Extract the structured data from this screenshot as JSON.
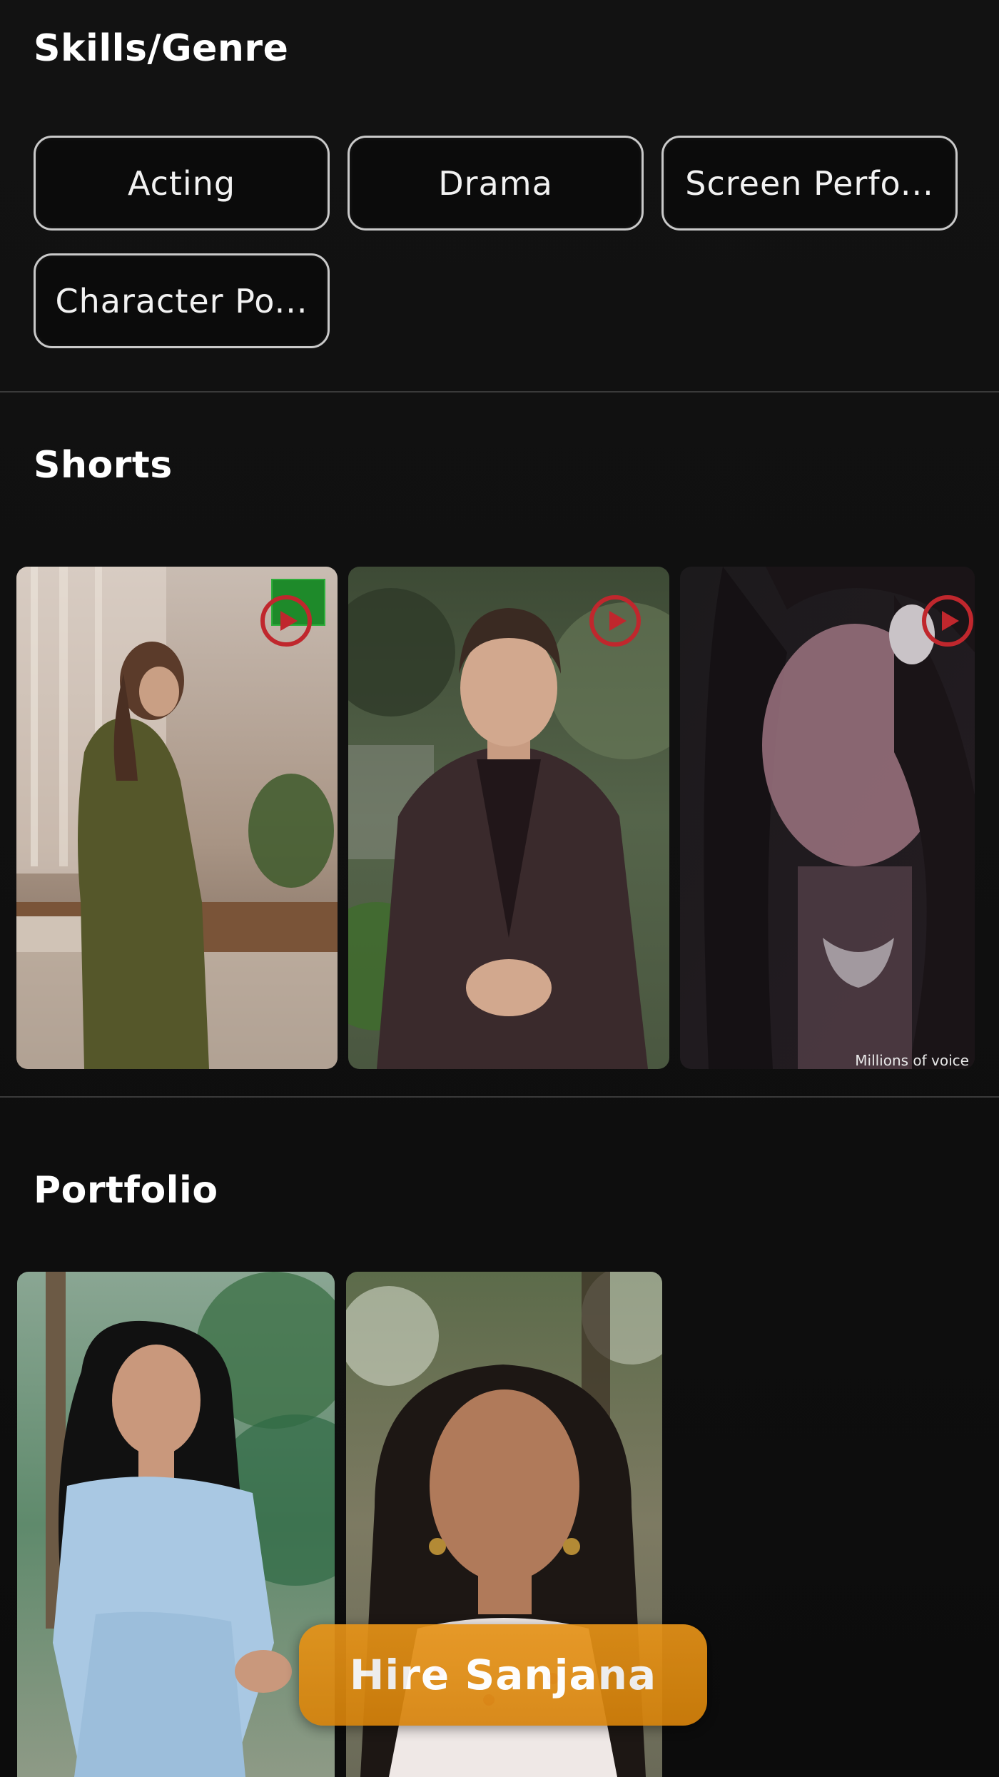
{
  "skills": {
    "title": "Skills/Genre",
    "chips": [
      "Acting",
      "Drama",
      "Screen Perfo...",
      "Character Po..."
    ]
  },
  "shorts": {
    "title": "Shorts",
    "items": [
      {
        "label": "Woman painting at a table",
        "play_icon": "play-circle-icon"
      },
      {
        "label": "Woman in brown blazer",
        "play_icon": "play-circle-icon"
      },
      {
        "label": "Woman with maang tikka",
        "play_icon": "play-circle-icon",
        "caption": "Millions of voice"
      }
    ]
  },
  "portfolio": {
    "title": "Portfolio",
    "items": [
      {
        "label": "Woman in light blue dress"
      },
      {
        "label": "Smiling woman with earrings"
      }
    ]
  },
  "cta": {
    "hire_label": "Hire Sanjana"
  },
  "colors": {
    "background": "#0f0f0f",
    "chip_border": "#c9c9c9",
    "play_icon": "#c0272d",
    "hire_button": "#e08e15",
    "divider": "#3a3a3a"
  }
}
